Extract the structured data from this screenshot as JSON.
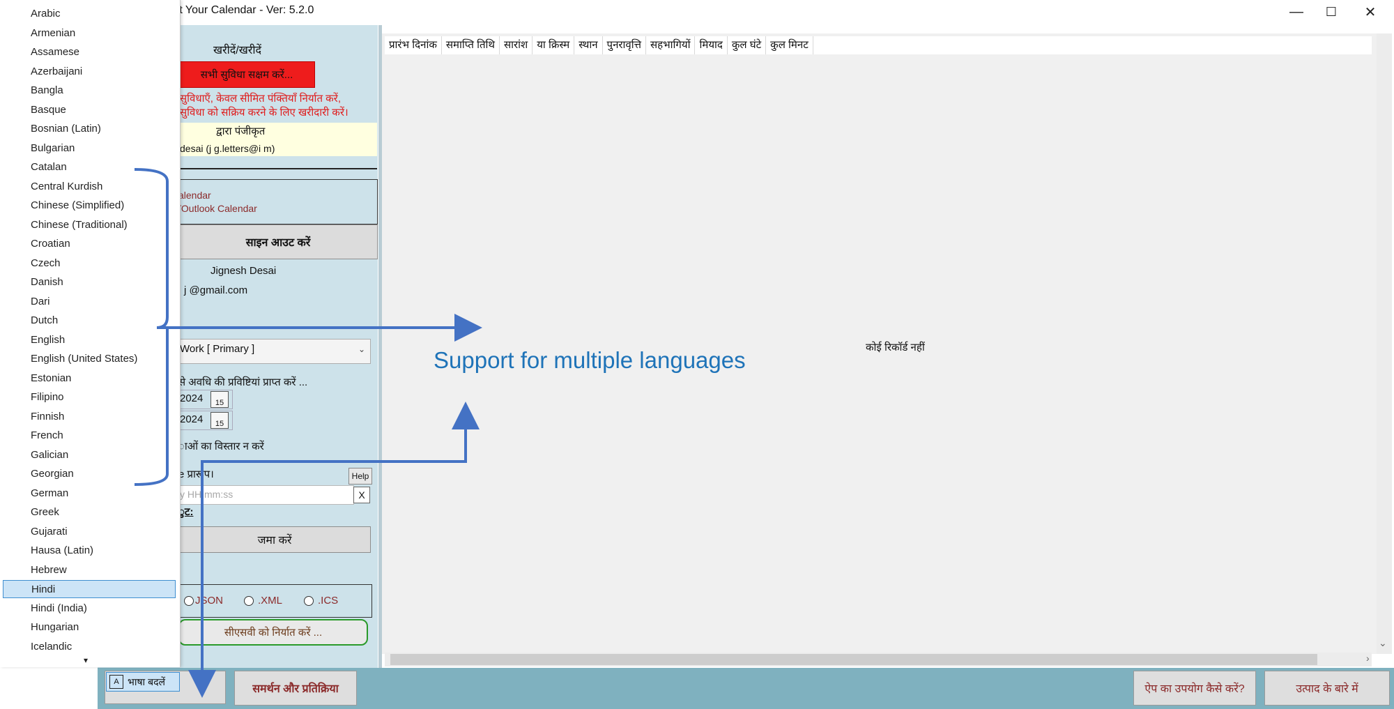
{
  "window": {
    "title": "rt Your Calendar - Ver: 5.2.0",
    "minimize_glyph": "—",
    "maximize_glyph": "☐",
    "close_glyph": "✕"
  },
  "left_panel": {
    "purchase_label": "खरीदें/खरीदें",
    "enable_all_button": "सभी सुविधा सक्षम करें...",
    "limited_line1": "सुविधाएँ, केवल सीमित पंक्तियाँ निर्यात करें,",
    "limited_line2": "सुविधा को सक्रिय करने के लिए खरीदारी करें।",
    "registered_by": "द्वारा पंजीकृत",
    "registered_user": "desai (j g.letters@i m)",
    "calendar_option_line1": "alendar",
    "calendar_option_line2": "/Outlook Calendar",
    "sign_out_button": "साइन आउट करें",
    "user_name": "Jignesh Desai",
    "user_email": "j @gmail.com",
    "calendar_select": "Work [ Primary ]",
    "fetch_period_label": "से अवधि की प्रविष्टियां प्राप्त करें ...",
    "date_from": "2024",
    "date_to": "2024",
    "calendar_icon_number": "15",
    "no_expand_label": "ाओं का विस्तार न करें",
    "format_label": "e प्रारूप।",
    "help_button": "Help",
    "time_format_placeholder": "y HH:mm:ss",
    "clear_button": "X",
    "output_label": "ुट:",
    "submit_button": "जमा करें",
    "format_options": [
      "JSON",
      ".XML",
      ".ICS"
    ],
    "export_button": "सीएसवी को निर्यात करें ..."
  },
  "grid": {
    "columns": [
      "प्रारंभ दिनांक",
      "समाप्ति तिथि",
      "सारांश",
      "या क्रिस्म",
      "स्थान",
      "पुनरावृत्ति",
      "सहभागियों",
      "मियाद",
      "कुल घंटे",
      "कुल मिनट"
    ],
    "empty_message": "कोई रिकॉर्ड नहीं"
  },
  "bottom_bar": {
    "change_language_button": "भाषा बदलें",
    "support_button": "समर्थन और प्रतिक्रिया",
    "how_to_use_button": "ऐप का उपयोग कैसे करें?",
    "about_button": "उत्पाद के बारे में"
  },
  "language_list": {
    "items": [
      "Arabic",
      "Armenian",
      "Assamese",
      "Azerbaijani",
      "Bangla",
      "Basque",
      "Bosnian (Latin)",
      "Bulgarian",
      "Catalan",
      "Central Kurdish",
      "Chinese (Simplified)",
      "Chinese (Traditional)",
      "Croatian",
      "Czech",
      "Danish",
      "Dari",
      "Dutch",
      "English",
      "English (United States)",
      "Estonian",
      "Filipino",
      "Finnish",
      "French",
      "Galician",
      "Georgian",
      "German",
      "Greek",
      "Gujarati",
      "Hausa (Latin)",
      "Hebrew",
      "Hindi",
      "Hindi (India)",
      "Hungarian",
      "Icelandic"
    ],
    "selected": "Hindi",
    "scroll_down_glyph": "▾"
  },
  "annotation": {
    "text": "Support for multiple languages"
  },
  "colors": {
    "panel_bg": "#cde2ea",
    "bottom_bar": "#7fb1bf",
    "enable_button_red": "#ee1c1c",
    "warning_text": "#e01b1b",
    "annotation_blue": "#1e73b8",
    "selected_item": "#cce4f7"
  }
}
